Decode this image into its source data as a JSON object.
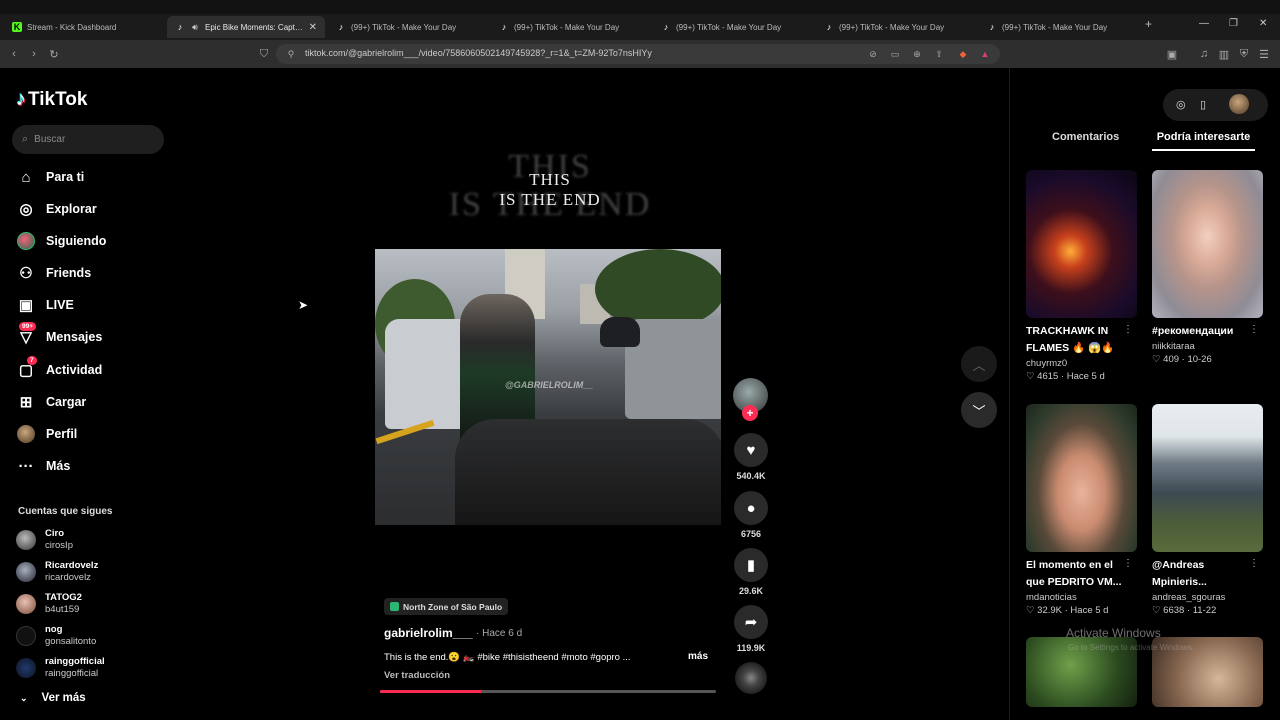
{
  "browser": {
    "tabs": [
      {
        "title": "Stream - Kick Dashboard",
        "icon": "kick-icon",
        "active": false
      },
      {
        "title": "Epic Bike Moments: Capturin",
        "icon": "tiktok-icon",
        "active": true
      },
      {
        "title": "(99+) TikTok - Make Your Day",
        "icon": "tiktok-icon",
        "active": false
      },
      {
        "title": "(99+) TikTok - Make Your Day",
        "icon": "tiktok-icon",
        "active": false
      },
      {
        "title": "(99+) TikTok - Make Your Day",
        "icon": "tiktok-icon",
        "active": false
      },
      {
        "title": "(99+) TikTok - Make Your Day",
        "icon": "tiktok-icon",
        "active": false
      },
      {
        "title": "(99+) TikTok - Make Your Day",
        "icon": "tiktok-icon",
        "active": false
      }
    ],
    "url": "tiktok.com/@gabrielrolim___/video/7586060502149745928?_r=1&_t=ZM-92To7nsHIYy"
  },
  "sidebar": {
    "logo": "TikTok",
    "search_placeholder": "Buscar",
    "nav": [
      {
        "label": "Para ti",
        "icon": "home-icon"
      },
      {
        "label": "Explorar",
        "icon": "compass-icon"
      },
      {
        "label": "Siguiendo",
        "icon": "following-icon"
      },
      {
        "label": "Friends",
        "icon": "friends-icon"
      },
      {
        "label": "LIVE",
        "icon": "live-icon"
      },
      {
        "label": "Mensajes",
        "icon": "messages-icon",
        "badge": "99+"
      },
      {
        "label": "Actividad",
        "icon": "activity-icon",
        "badge": "7"
      },
      {
        "label": "Cargar",
        "icon": "upload-icon"
      },
      {
        "label": "Perfil",
        "icon": "profile-icon"
      },
      {
        "label": "Más",
        "icon": "more-icon"
      }
    ],
    "following_title": "Cuentas que sigues",
    "following": [
      {
        "name": "Ciro",
        "user": "cirosIp"
      },
      {
        "name": "Ricardovelz",
        "user": "ricardovelz"
      },
      {
        "name": "TATOG2",
        "user": "b4ut159"
      },
      {
        "name": "nog",
        "user": "gonsalitonto"
      },
      {
        "name": "rainggofficial",
        "user": "rainggofficial"
      }
    ],
    "see_more": "Ver más"
  },
  "video": {
    "overlay_big": [
      "THIS",
      "IS THE END"
    ],
    "overlay_small": [
      "THIS",
      "IS THE END"
    ],
    "watermark": "@GABRIELROLIM__",
    "progress": 0.3,
    "location": "North Zone of São Paulo",
    "author": "gabrielrolim___",
    "posted": "· Hace 6 d",
    "description": "This is the end.😮 🏍️ #bike #thisistheend #moto #gopro ...",
    "more": "más",
    "translate": "Ver traducción"
  },
  "actions": {
    "likes": "540.4K",
    "comments": "6756",
    "saves": "29.6K",
    "shares": "119.9K"
  },
  "right_panel": {
    "tabs": [
      "Comentarios",
      "Podría interesarte"
    ],
    "active_tab": "Podría interesarte",
    "cards": [
      {
        "title": "TRACKHAWK IN FLAMES 🔥 😱🔥",
        "user": "chuyrmz0",
        "stats": "♡ 4615 · Hace 5 d"
      },
      {
        "title": "#рекомендации",
        "user": "niikkitaraa",
        "stats": "♡ 409 · 10-26"
      },
      {
        "title": "El momento en el que PEDRITO VM...",
        "user": "mdanoticias",
        "stats": "♡ 32.9K · Hace 5 d"
      },
      {
        "title": "@Andreas Mpinieris...",
        "user": "andreas_sgouras",
        "stats": "♡ 6638 · 11-22"
      }
    ]
  },
  "system": {
    "activate_title": "Activate Windows",
    "activate_sub": "Go to Settings to activate Windows."
  },
  "colors": {
    "accent": "#fe2c55",
    "background": "#000000",
    "location_icon": "#2bb673"
  }
}
